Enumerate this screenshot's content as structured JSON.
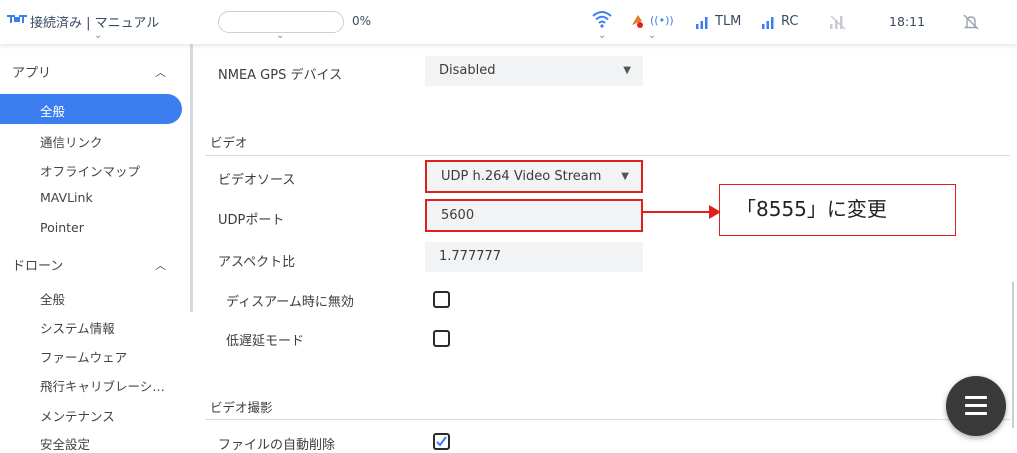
{
  "topbar": {
    "connection_status": "接続済み | マニュアル",
    "progress_percent": "0%",
    "progress_value": 0,
    "tlm_label": "TLM",
    "rc_label": "RC",
    "time": "18:11"
  },
  "sidebar": {
    "app_section": "アプリ",
    "app_items": [
      "全般",
      "通信リンク",
      "オフラインマップ",
      "MAVLink",
      "Pointer"
    ],
    "active_item": "全般",
    "drone_section": "ドローン",
    "drone_items": [
      "全般",
      "システム情報",
      "ファームウェア",
      "飛行キャリブレーシ…",
      "メンテナンス",
      "安全設定"
    ]
  },
  "main": {
    "nmea_label": "NMEA GPS デバイス",
    "nmea_value": "Disabled",
    "video_section": "ビデオ",
    "video_source_label": "ビデオソース",
    "video_source_value": "UDP h.264 Video Stream",
    "udp_port_label": "UDPポート",
    "udp_port_value": "5600",
    "aspect_label": "アスペクト比",
    "aspect_value": "1.777777",
    "disarm_label": "ディスアーム時に無効",
    "disarm_checked": false,
    "lowlatency_label": "低遅延モード",
    "lowlatency_checked": false,
    "recording_section": "ビデオ撮影",
    "auto_delete_label": "ファイルの自動削除",
    "auto_delete_checked": true
  },
  "annotation": {
    "callout_text": "「8555」に変更",
    "color": "#e0201b"
  },
  "colors": {
    "accent": "#3b7ef0",
    "highlight": "#e0201b",
    "fab": "#3a3a3a"
  }
}
